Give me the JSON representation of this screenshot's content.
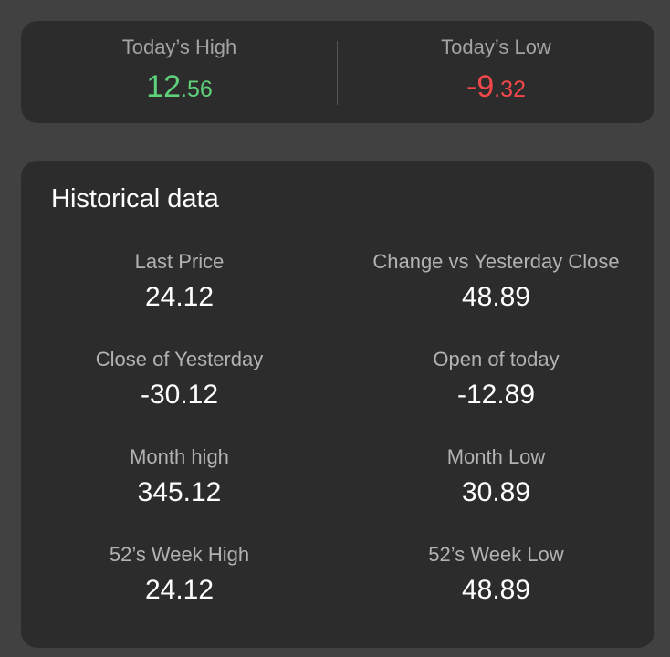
{
  "today": {
    "high": {
      "label": "Today’s High",
      "int": "12",
      "dec": ".56",
      "color": "#5fd17a"
    },
    "low": {
      "label": "Today’s Low",
      "int": "-9",
      "dec": ".32",
      "color": "#f0474a"
    }
  },
  "historical": {
    "title": "Historical data",
    "items": [
      {
        "label": "Last Price",
        "value": "24.12"
      },
      {
        "label": "Change vs Yesterday Close",
        "value": "48.89"
      },
      {
        "label": "Close of Yesterday",
        "value": "-30.12"
      },
      {
        "label": "Open of today",
        "value": "-12.89"
      },
      {
        "label": "Month high",
        "value": "345.12"
      },
      {
        "label": "Month Low",
        "value": "30.89"
      },
      {
        "label": "52’s Week High",
        "value": "24.12"
      },
      {
        "label": "52’s Week Low",
        "value": "48.89"
      }
    ]
  }
}
